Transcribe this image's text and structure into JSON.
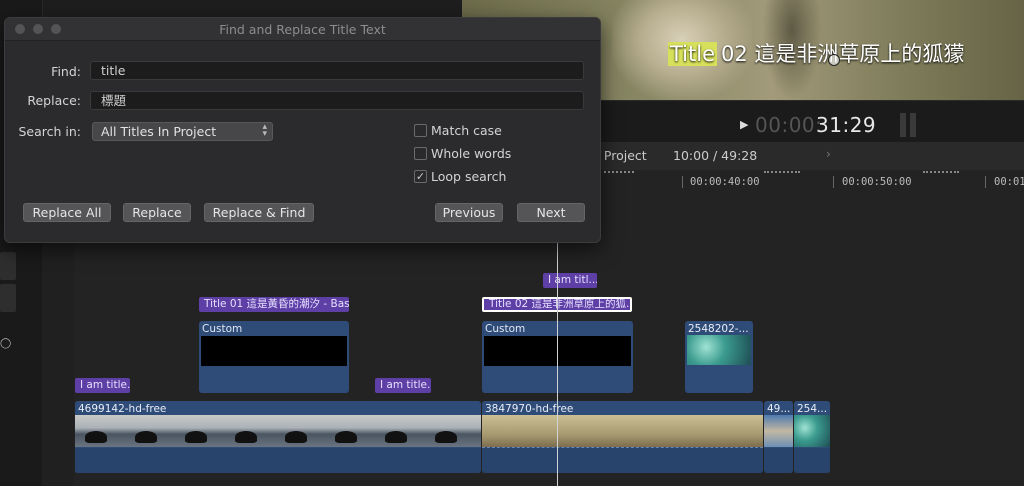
{
  "dialog": {
    "title": "Find and Replace Title Text",
    "find_label": "Find:",
    "find_value": "title",
    "replace_label": "Replace:",
    "replace_value": "標題",
    "search_in_label": "Search in:",
    "search_in_value": "All Titles In Project",
    "checkboxes": [
      {
        "label": "Match case",
        "checked": false
      },
      {
        "label": "Whole words",
        "checked": false
      },
      {
        "label": "Loop search",
        "checked": true
      }
    ],
    "buttons": {
      "replace_all": "Replace All",
      "replace": "Replace",
      "replace_find": "Replace & Find",
      "previous": "Previous",
      "next": "Next"
    }
  },
  "viewer": {
    "subtitle_highlight": "Title",
    "subtitle_rest": "02 這是非洲草原上的狐獴",
    "timecode_dim": "00:00:",
    "timecode_bright": "31:29"
  },
  "timeline": {
    "project_fragment": "d Project",
    "position": "10:00 / 49:28",
    "ruler_labels": [
      "00:00:40:00",
      "00:00:50:00",
      "00:01"
    ],
    "title_clips": [
      "I am titl...",
      "Title 01 這是黃昏的潮汐 - Bas...",
      "Title 02 這是非洲草原上的狐...",
      "I am title...",
      "I am title..."
    ],
    "custom_clips": [
      "Custom",
      "Custom"
    ],
    "video_clips": [
      "2548202-...",
      "4699142-hd-free",
      "3847970-hd-free",
      "49...",
      "254..."
    ]
  },
  "colors": {
    "title_clip": "#5d3fa6",
    "video_clip": "#2f4c78",
    "highlight": "#d6e05a"
  }
}
